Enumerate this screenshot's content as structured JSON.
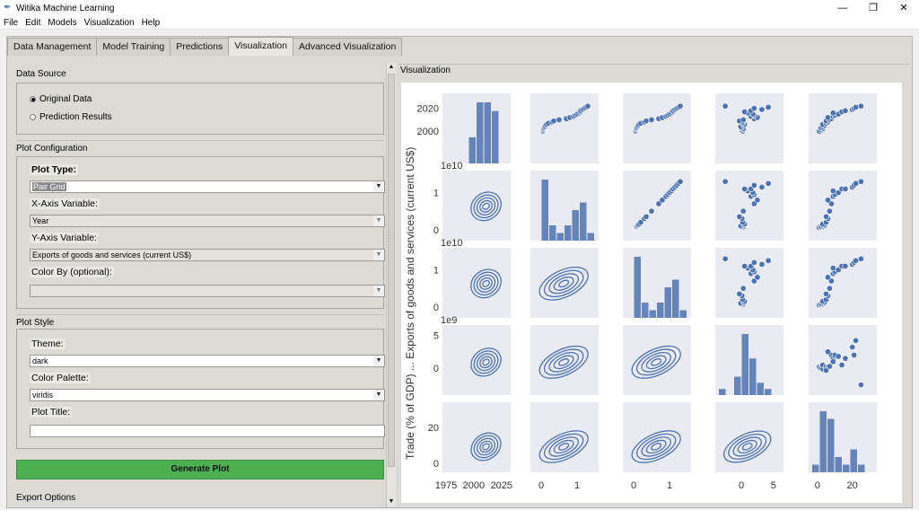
{
  "window": {
    "title": "Witika Machine Learning",
    "minimize": "—",
    "restore": "❐",
    "close": "✕"
  },
  "menubar": [
    "File",
    "Edit",
    "Models",
    "Visualization",
    "Help"
  ],
  "tabs": [
    {
      "label": "Data Management",
      "active": false
    },
    {
      "label": "Model Training",
      "active": false
    },
    {
      "label": "Predictions",
      "active": false
    },
    {
      "label": "Visualization",
      "active": true
    },
    {
      "label": "Advanced Visualization",
      "active": false
    }
  ],
  "data_source": {
    "title": "Data Source",
    "options": [
      "Original Data",
      "Prediction Results"
    ],
    "selected": "Original Data"
  },
  "plot_config": {
    "title": "Plot Configuration",
    "plot_type_label": "Plot Type:",
    "plot_type_value": "Pair Grid",
    "x_label": "X-Axis Variable:",
    "x_value": "Year",
    "y_label": "Y-Axis Variable:",
    "y_value": "Exports of goods and services (current US$)",
    "color_label": "Color By (optional):",
    "color_value": ""
  },
  "plot_style": {
    "title": "Plot Style",
    "theme_label": "Theme:",
    "theme_value": "dark",
    "palette_label": "Color Palette:",
    "palette_value": "viridis",
    "plot_title_label": "Plot Title:",
    "plot_title_value": ""
  },
  "generate_button": "Generate Plot",
  "export_options": "Export Options",
  "visualization": {
    "title": "Visualization"
  },
  "chart_data": {
    "type": "scatter",
    "title": "",
    "grid": "pair grid 5x5 (histograms on diagonal, scatter upper, kde lower)",
    "accent_color": "#4c72b0",
    "facet_background": "#eaeaf2",
    "y_axis_label_visible": "Trade (% of GDP) ... Exports of goods and services (current US$)",
    "tick_labels": {
      "row0_y": [
        "2000",
        "2020"
      ],
      "row1_y": [
        "0",
        "1"
      ],
      "row2_y": [
        "0",
        "1"
      ],
      "row3_y": [
        "0",
        "5"
      ],
      "row4_y": [
        "0",
        "20"
      ],
      "col0_x": [
        "1975",
        "2000",
        "2025"
      ],
      "col1_x": [
        "0",
        "1"
      ],
      "col2_x": [
        "0",
        "1"
      ],
      "col3_x": [
        "0",
        "5"
      ],
      "col4_x": [
        "0",
        "20"
      ]
    },
    "offset_labels": [
      "1e10",
      "1e10",
      "1e9"
    ],
    "year": [
      2000,
      2001,
      2002,
      2003,
      2004,
      2005,
      2006,
      2007,
      2008,
      2009,
      2010,
      2011,
      2012,
      2013,
      2014,
      2015,
      2016,
      2017,
      2018,
      2019,
      2020,
      2021,
      2022
    ],
    "exports_1e10": [
      0.05,
      0.06,
      0.07,
      0.08,
      0.1,
      0.12,
      0.15,
      0.2,
      0.3,
      0.35,
      0.5,
      0.7,
      0.8,
      0.9,
      0.95,
      1.0,
      1.05,
      1.1,
      1.1,
      1.15,
      1.2,
      1.25,
      1.3
    ],
    "imports_1e10": [
      0.05,
      0.06,
      0.07,
      0.08,
      0.1,
      0.12,
      0.15,
      0.2,
      0.3,
      0.35,
      0.5,
      0.7,
      0.8,
      0.9,
      0.95,
      1.0,
      1.05,
      1.1,
      1.1,
      1.15,
      1.2,
      1.25,
      1.3
    ],
    "var4_1e9": [
      0.2,
      0.1,
      0.3,
      0.0,
      -0.1,
      0.4,
      0.5,
      0.2,
      0.1,
      -0.3,
      0.3,
      2.0,
      2.5,
      1.5,
      2.0,
      1.8,
      1.0,
      0.5,
      1.5,
      3.2,
      2.0,
      4.2,
      -2.5
    ],
    "trade_pct_gdp": [
      1,
      2,
      3,
      2,
      3,
      4,
      3,
      5,
      6,
      5,
      7,
      8,
      6,
      9,
      10,
      12,
      9,
      14,
      16,
      20,
      21,
      22,
      25
    ]
  }
}
